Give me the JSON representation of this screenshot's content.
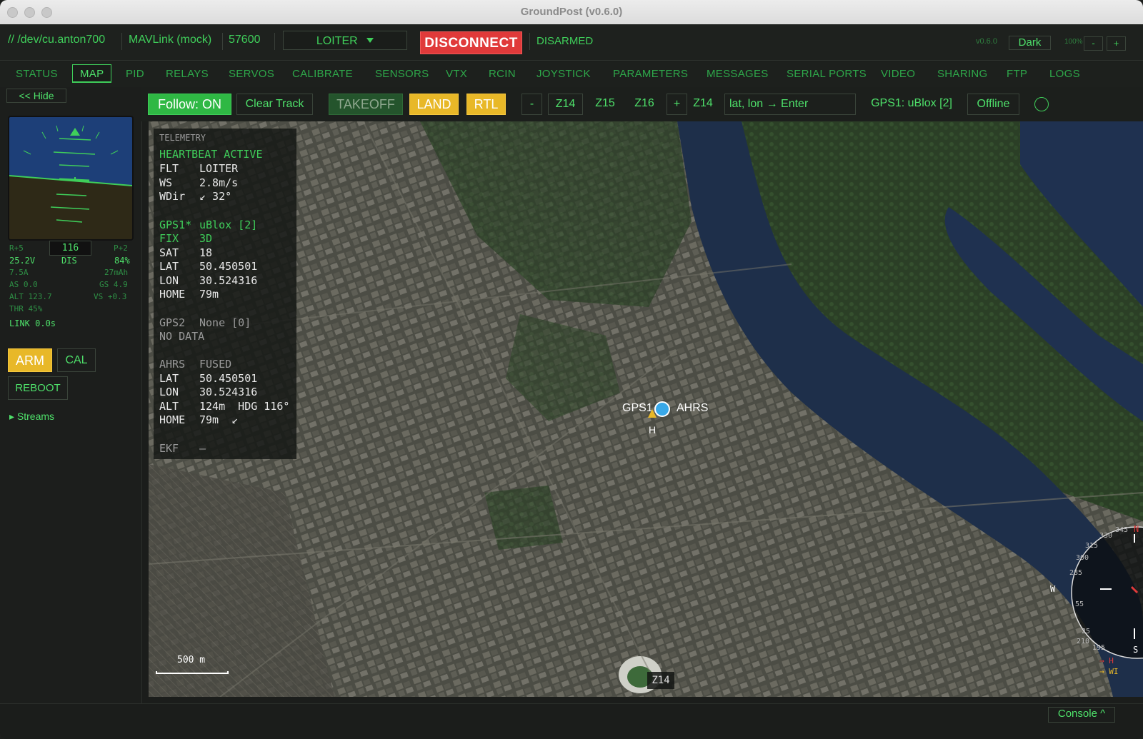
{
  "window": {
    "title": "GroundPost (v0.6.0)"
  },
  "topbar": {
    "port": "// /dev/cu.anton700",
    "protocol": "MAVLink (mock)",
    "baud": "57600",
    "flight_mode": "LOITER",
    "disconnect_label": "DISCONNECT",
    "arm_state": "DISARMED",
    "version": "v0.6.0",
    "theme": "Dark",
    "zoom": "100%",
    "zoom_minus": "-",
    "zoom_plus": "+"
  },
  "nav": {
    "tabs": [
      "STATUS",
      "MAP",
      "PID",
      "RELAYS",
      "SERVOS",
      "CALIBRATE",
      "SENSORS",
      "VTX",
      "RCIN",
      "JOYSTICK",
      "PARAMETERS",
      "MESSAGES",
      "SERIAL PORTS",
      "VIDEO",
      "SHARING",
      "FTP",
      "LOGS"
    ],
    "active": "MAP"
  },
  "left": {
    "hide_label": "<< Hide",
    "roll": "R+5",
    "heading_box": "116",
    "pitch": "P+2",
    "voltage": "25.2V",
    "dis": "DIS",
    "battery": "84%",
    "current": "7.5A",
    "mah": "27mAh",
    "airspeed": "AS 0.0",
    "groundspeed": "GS 4.9",
    "altitude": "ALT 123.7",
    "vspeed": "VS +0.3",
    "throttle": "THR 45%",
    "link": "LINK  0.0s",
    "arm_label": "ARM",
    "cal_label": "CAL",
    "reboot_label": "REBOOT",
    "streams_label": "▸ Streams"
  },
  "maptoolbar": {
    "follow": "Follow: ON",
    "clear": "Clear Track",
    "takeoff": "TAKEOFF",
    "land": "LAND",
    "rtl": "RTL",
    "zoom_out": "-",
    "z14": "Z14",
    "z15": "Z15",
    "z16": "Z16",
    "zoom_in": "+",
    "zoom_current": "Z14",
    "coord_input": "lat, lon → Enter",
    "gps_source": "GPS1: uBlox [2]",
    "offline": "Offline"
  },
  "telemetry": {
    "header": "TELEMETRY",
    "heartbeat": "HEARTBEAT ACTIVE",
    "flt_key": "FLT",
    "flt_val": "LOITER",
    "ws_key": "WS",
    "ws_val": "2.8m/s",
    "wdir_key": "WDir",
    "wdir_val": "↙ 32°",
    "gps1_key": "GPS1*",
    "gps1_val": "uBlox [2]",
    "fix_key": "FIX",
    "fix_val": "3D",
    "sat_key": "SAT",
    "sat_val": "18",
    "lat_key": "LAT",
    "lat_val": "50.450501",
    "lon_key": "LON",
    "lon_val": "30.524316",
    "home_key": "HOME",
    "home_val": "79m",
    "gps2_key": "GPS2",
    "gps2_val": "None [0]",
    "nodata": "NO DATA",
    "ahrs_key": "AHRS",
    "ahrs_val": "FUSED",
    "alat_key": "LAT",
    "alat_val": "50.450501",
    "alon_key": "LON",
    "alon_val": "30.524316",
    "alt_key": "ALT",
    "alt_val": "124m  HDG 116°",
    "ahome_key": "HOME",
    "ahome_val": "79m  ↙",
    "ekf_key": "EKF",
    "ekf_val": "—"
  },
  "map": {
    "gps_label": "GPS1",
    "ahrs_label": "AHRS",
    "home_label": "H",
    "scale": "500 m",
    "zoom_badge": "Z14",
    "compass": {
      "n": "N",
      "w": "W",
      "s": "S",
      "t345": "345",
      "t330": "330",
      "t315": "315",
      "t300": "300",
      "t285": "285",
      "t255": "55",
      "t240": "25",
      "t210": "210",
      "t195": "195",
      "h": "→ H",
      "wi": "→ WI"
    }
  },
  "console_label": "Console ^",
  "colors": {
    "accent": "#3fce5a",
    "danger": "#e03a3a",
    "warning": "#e8b828"
  }
}
